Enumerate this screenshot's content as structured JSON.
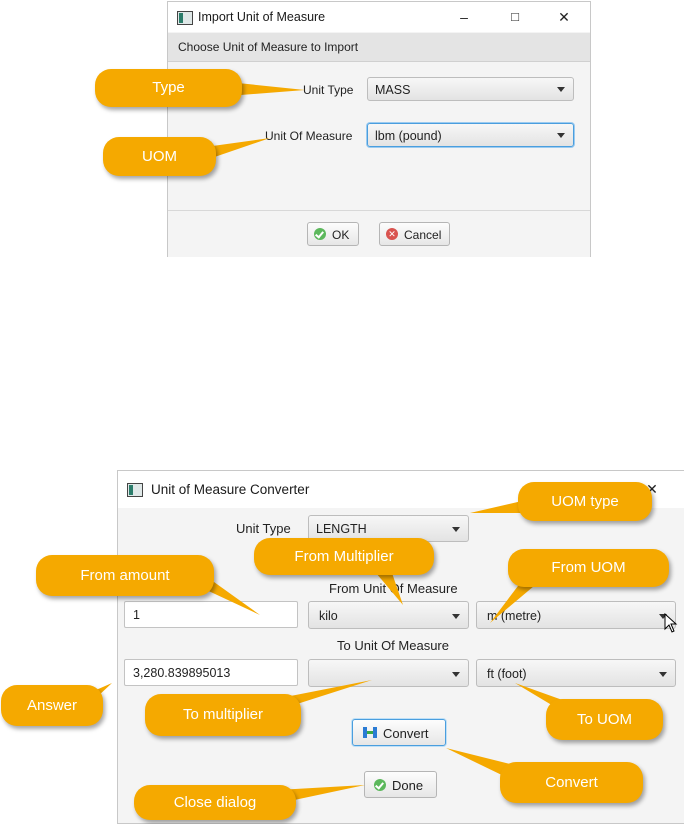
{
  "import_dialog": {
    "title": "Import Unit of Measure",
    "header": "Choose Unit of Measure to Import",
    "unit_type_label": "Unit Type",
    "unit_type_value": "MASS",
    "uom_label": "Unit Of Measure",
    "uom_value": "lbm (pound)",
    "ok_label": "OK",
    "cancel_label": "Cancel"
  },
  "converter_dialog": {
    "title": "Unit of Measure Converter",
    "unit_type_label": "Unit Type",
    "unit_type_value": "LENGTH",
    "from_section_label": "From Unit Of Measure",
    "from_amount": "1",
    "from_multiplier": "kilo",
    "from_uom": "m (metre)",
    "to_section_label": "To Unit Of Measure",
    "answer": "3,280.839895013",
    "to_multiplier": "",
    "to_uom": "ft (foot)",
    "convert_label": "Convert",
    "done_label": "Done"
  },
  "callouts": {
    "type": "Type",
    "uom": "UOM",
    "uom_type": "UOM type",
    "from_multiplier": "From Multiplier",
    "from_amount": "From amount",
    "from_uom": "From UOM",
    "answer": "Answer",
    "to_multiplier": "To multiplier",
    "to_uom": "To UOM",
    "convert": "Convert",
    "close_dialog": "Close dialog"
  },
  "colors": {
    "callout": "#f5a900",
    "focus_border": "#4a9ede",
    "ok_icon": "#5cb85c",
    "cancel_icon": "#d9534f"
  }
}
